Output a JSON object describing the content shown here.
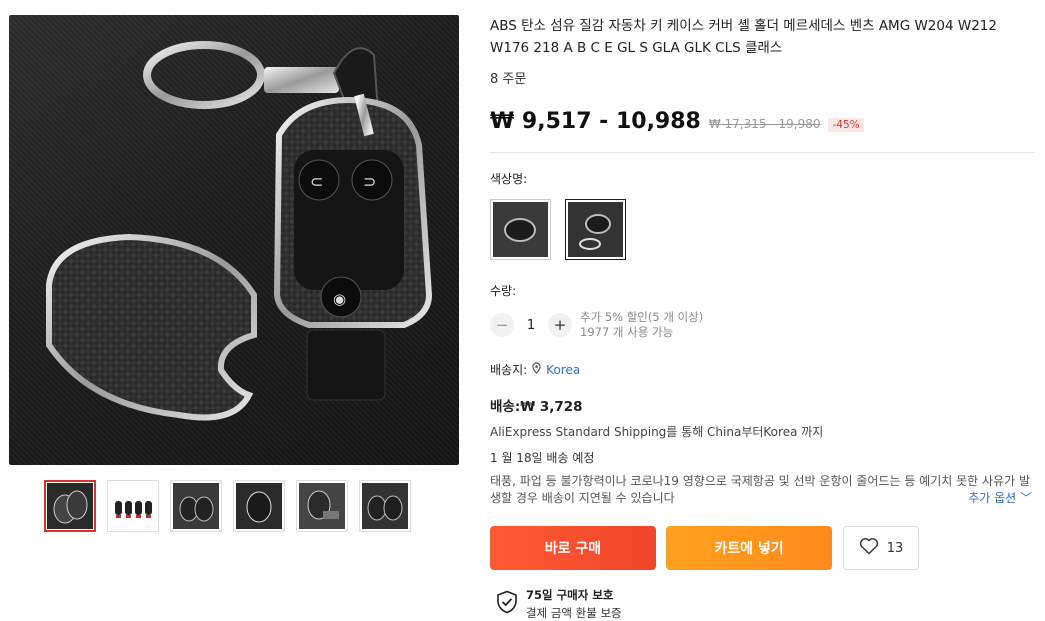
{
  "product": {
    "title": "ABS 탄소 섬유 질감 자동차 키 케이스 커버 셸 홀더 메르세데스 벤츠 AMG W204 W212 W176 218 A B C E GL S GLA GLK CLS 클래스",
    "orders": "8 주문",
    "price": "₩ 9,517 - 10,988",
    "old_price": "₩ 17,315 - 19,980",
    "discount": "-45%"
  },
  "color": {
    "label": "색상명:",
    "options": [
      "key-case-only",
      "key-case-with-keyring"
    ]
  },
  "quantity": {
    "label": "수량:",
    "minus": "−",
    "value": "1",
    "plus": "+",
    "promo": "추가 5% 할인(5 개 이상)",
    "available": "1977 개 사용 가능"
  },
  "shipping": {
    "to_label": "배송지:",
    "country": "Korea",
    "cost": "배송:₩ 3,728",
    "method": "AliExpress Standard Shipping를 통해 China부터Korea 까지",
    "eta": "1 월 18일 배송 예정",
    "notice": "태풍, 파업 등 불가항력이나 코로나19 영향으로 국제항공 및 선박 운항이 줄어드는 등 예기치 못한 사유가 발생할 경우 배송이 지연될 수 있습니다",
    "more_options": "추가 옵션 ﹀"
  },
  "actions": {
    "buy_now": "바로 구매",
    "add_to_cart": "카트에 넣기",
    "wishlist_count": "13"
  },
  "protection": {
    "title": "75일 구매자 보호",
    "subtitle": "결제 금액 환불 보증"
  },
  "colors": {
    "price": "#111111",
    "discount": "#e0302b",
    "buy_button": "#f0452a",
    "cart_button": "#ff8a1c",
    "link": "#2f6fcf"
  }
}
